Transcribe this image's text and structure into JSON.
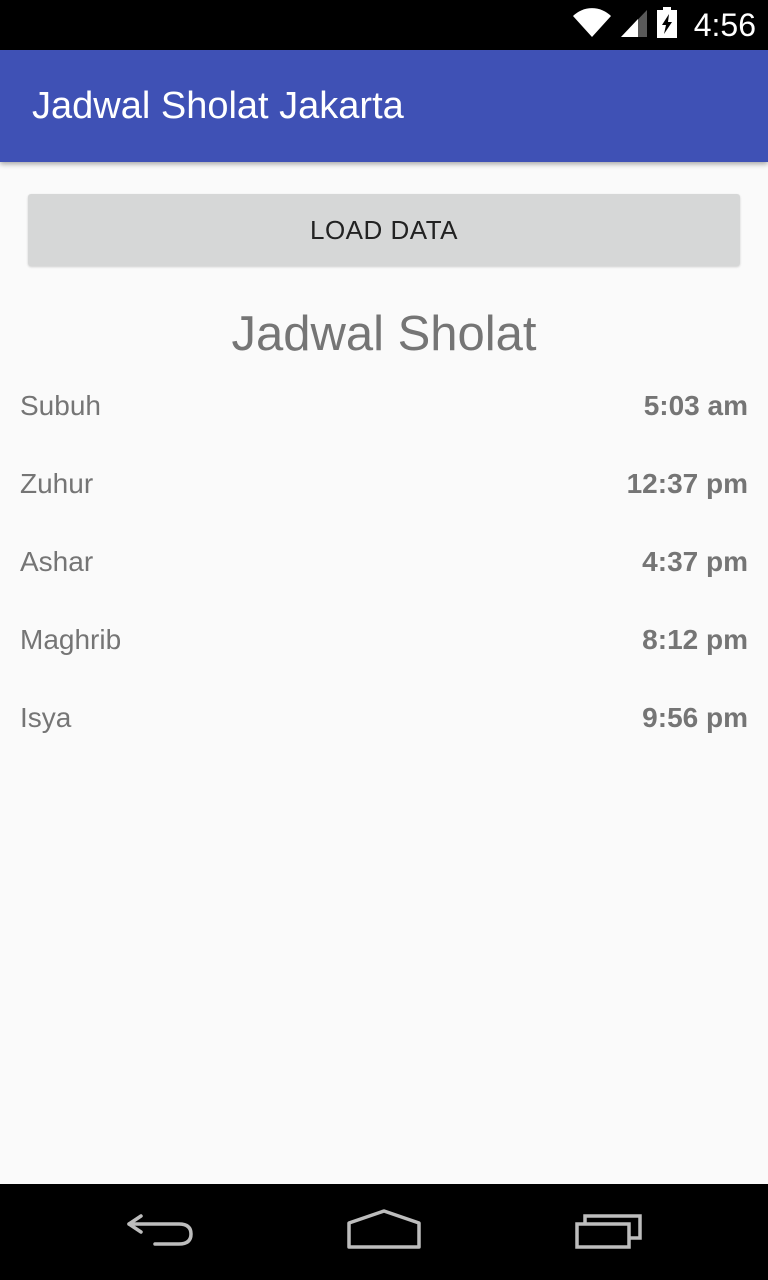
{
  "status_bar": {
    "time": "4:56",
    "icons": [
      "wifi-icon",
      "cell-signal-icon",
      "battery-charging-icon"
    ]
  },
  "app_bar": {
    "title": "Jadwal Sholat Jakarta",
    "color": "#3f51b5"
  },
  "load_button": {
    "label": "LOAD DATA"
  },
  "section": {
    "title": "Jadwal Sholat"
  },
  "schedule": [
    {
      "name": "Subuh",
      "time": "5:03 am"
    },
    {
      "name": "Zuhur",
      "time": "12:37 pm"
    },
    {
      "name": "Ashar",
      "time": "4:37 pm"
    },
    {
      "name": "Maghrib",
      "time": "8:12 pm"
    },
    {
      "name": "Isya",
      "time": "9:56 pm"
    }
  ],
  "nav_bar": {
    "icons": [
      "back-icon",
      "home-icon",
      "recents-icon"
    ]
  }
}
